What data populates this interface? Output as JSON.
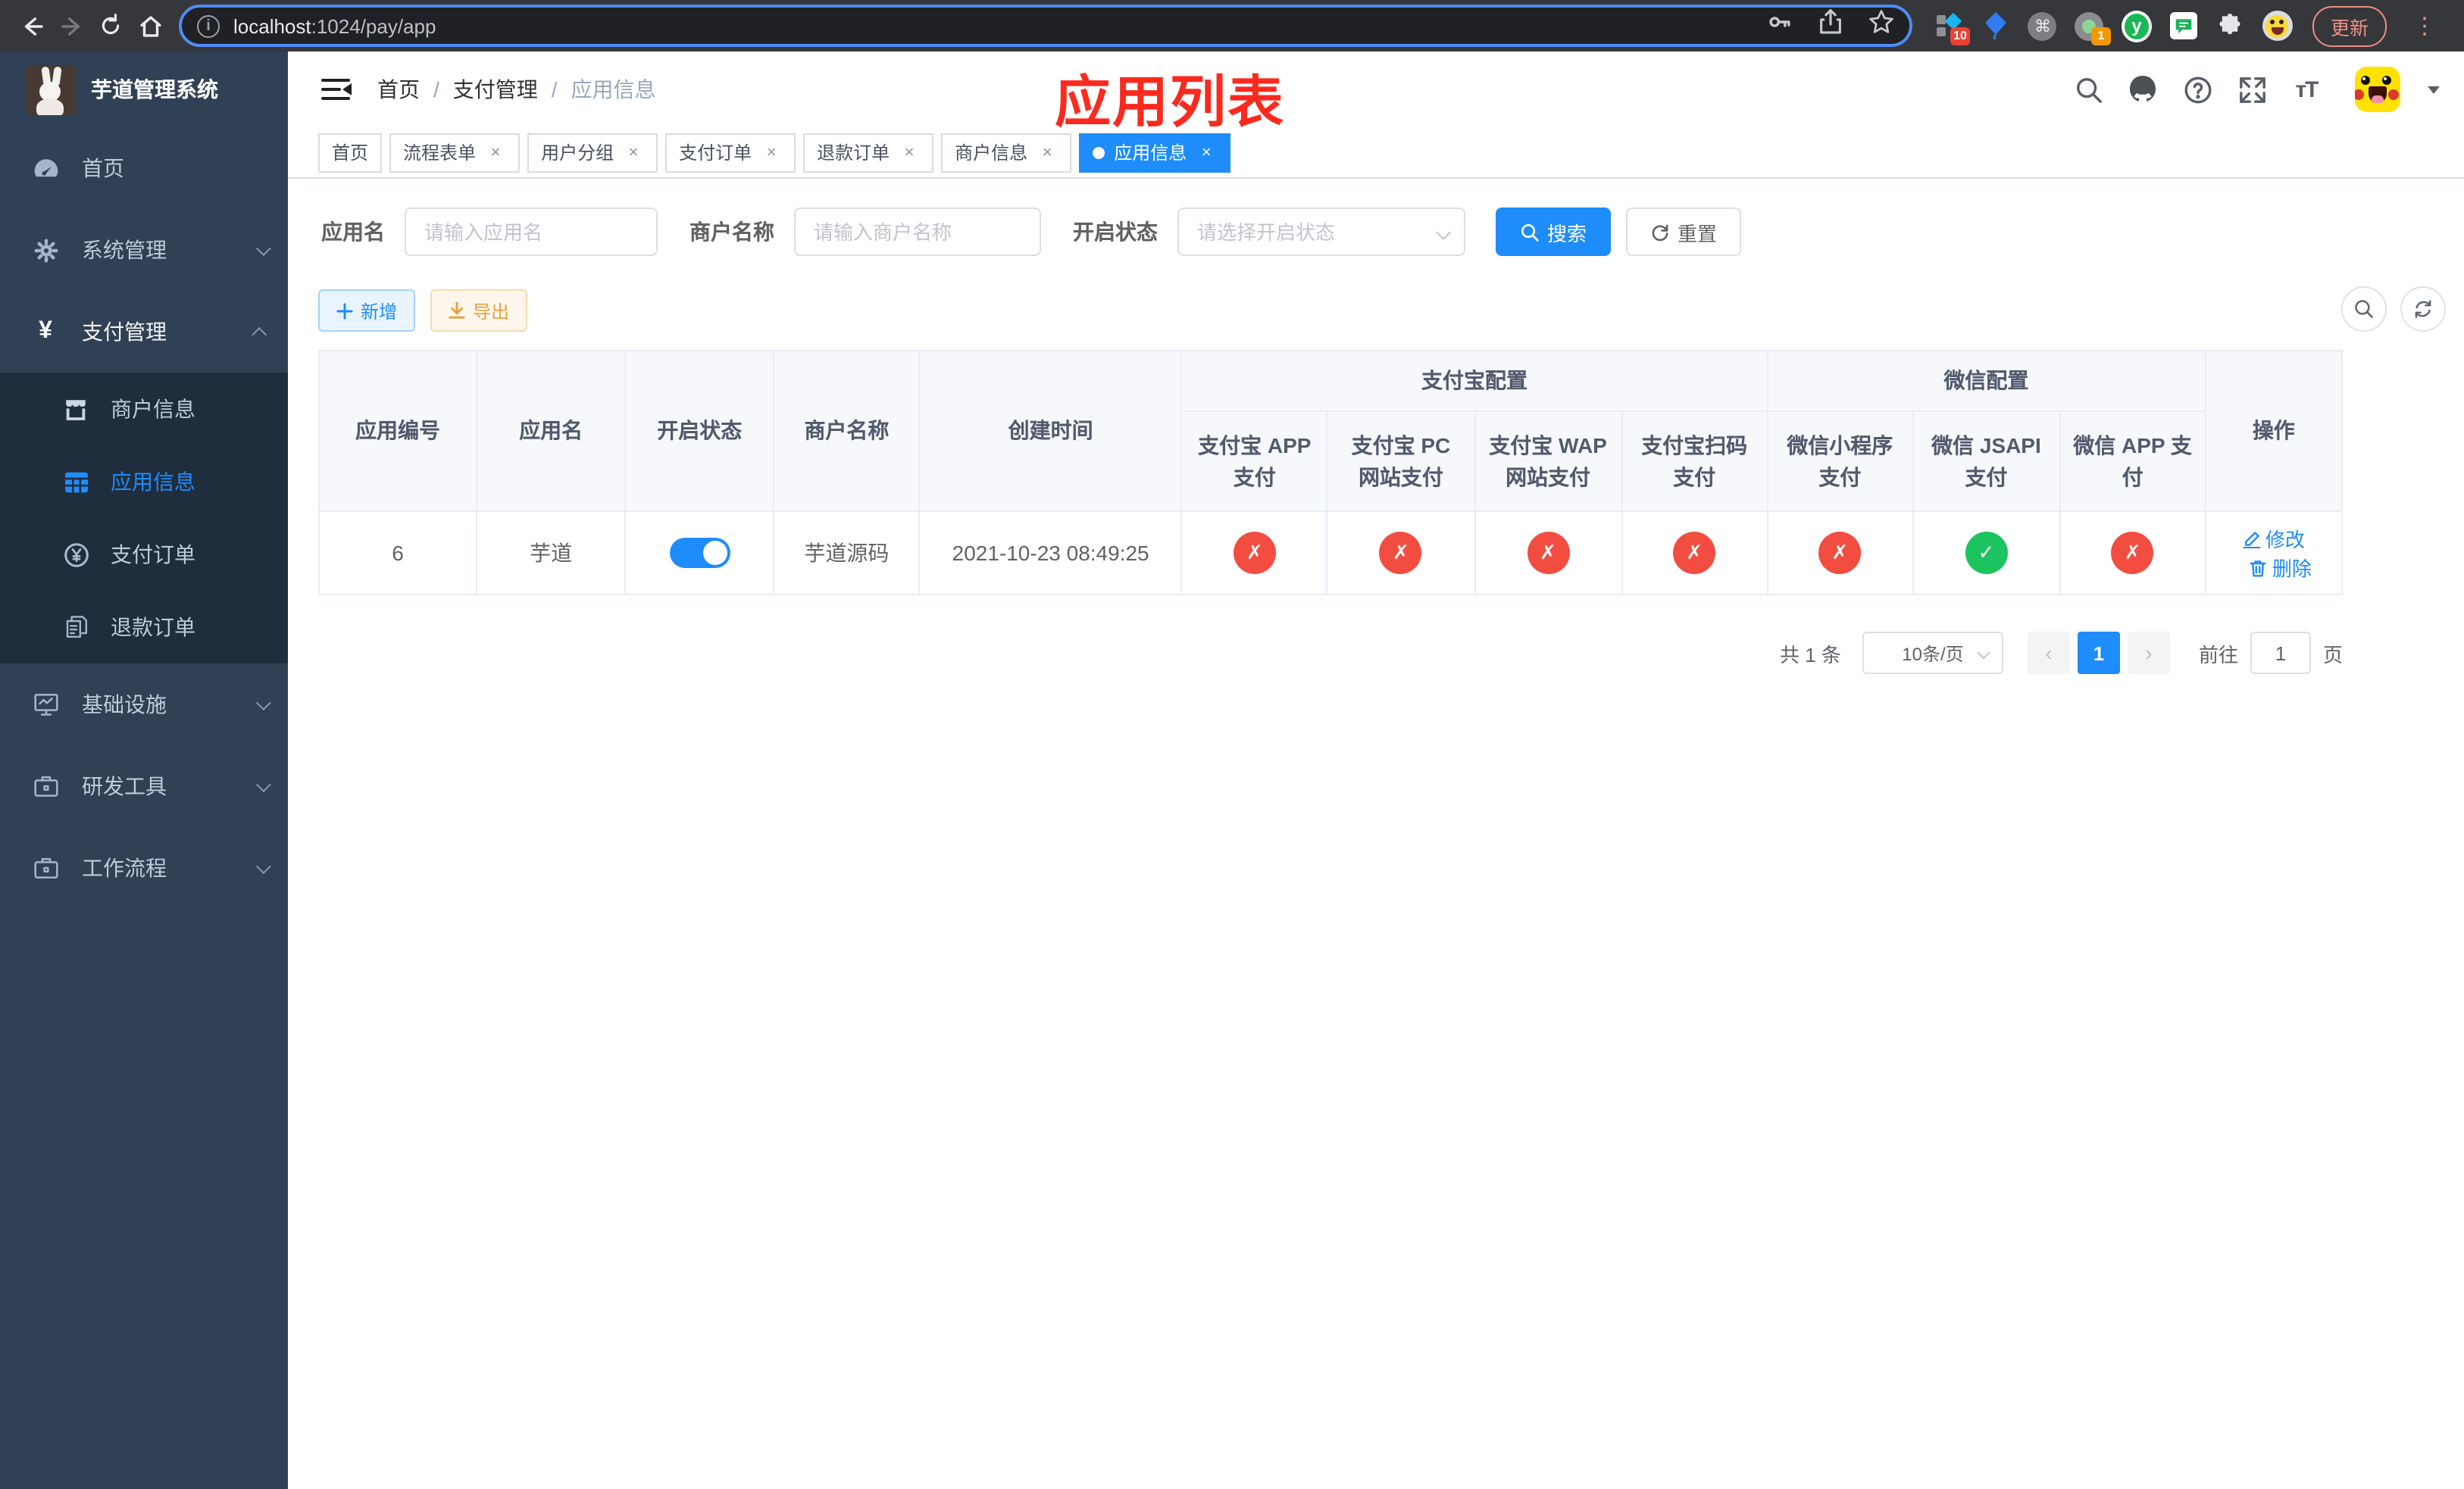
{
  "browser": {
    "url_host": "localhost",
    "url_path": ":1024/pay/app",
    "update_label": "更新",
    "ext_badge_grid": "10",
    "ext_badge_cam": "1",
    "ext_y_glyph": "y",
    "ext_cmd_glyph": "⌘"
  },
  "sidebar": {
    "title": "芋道管理系统",
    "items": [
      {
        "label": "首页"
      },
      {
        "label": "系统管理"
      },
      {
        "label": "支付管理"
      },
      {
        "label": "商户信息"
      },
      {
        "label": "应用信息"
      },
      {
        "label": "支付订单"
      },
      {
        "label": "退款订单"
      },
      {
        "label": "基础设施"
      },
      {
        "label": "研发工具"
      },
      {
        "label": "工作流程"
      }
    ]
  },
  "navbar": {
    "breadcrumb": [
      {
        "label": "首页"
      },
      {
        "label": "支付管理"
      },
      {
        "label": "应用信息"
      }
    ]
  },
  "annotation": {
    "text": "应用列表"
  },
  "tags": {
    "items": [
      {
        "label": "首页"
      },
      {
        "label": "流程表单"
      },
      {
        "label": "用户分组"
      },
      {
        "label": "支付订单"
      },
      {
        "label": "退款订单"
      },
      {
        "label": "商户信息"
      },
      {
        "label": "应用信息"
      }
    ]
  },
  "filters": {
    "app_name_label": "应用名",
    "app_name_placeholder": "请输入应用名",
    "merchant_label": "商户名称",
    "merchant_placeholder": "请输入商户名称",
    "status_label": "开启状态",
    "status_placeholder": "请选择开启状态",
    "search_label": "搜索",
    "reset_label": "重置"
  },
  "toolbar": {
    "add_label": "新增",
    "export_label": "导出"
  },
  "table": {
    "headers": {
      "app_id": "应用编号",
      "app_name": "应用名",
      "status": "开启状态",
      "merchant": "商户名称",
      "created": "创建时间",
      "alipay_group": "支付宝配置",
      "wechat_group": "微信配置",
      "ops": "操作",
      "sub": [
        "支付宝 APP 支付",
        "支付宝 PC 网站支付",
        "支付宝 WAP 网站支付",
        "支付宝扫码支付",
        "微信小程序支付",
        "微信 JSAPI 支付",
        "微信 APP 支付"
      ]
    },
    "row": {
      "app_id": "6",
      "app_name": "芋道",
      "enabled": true,
      "merchant": "芋道源码",
      "created": "2021-10-23 08:49:25",
      "configs": [
        false,
        false,
        false,
        false,
        false,
        true,
        false
      ],
      "edit_label": "修改",
      "delete_label": "删除"
    }
  },
  "pagination": {
    "total_text": "共 1 条",
    "page_size": "10条/页",
    "current_page": "1",
    "goto_prefix": "前往",
    "goto_value": "1",
    "goto_suffix": "页"
  }
}
